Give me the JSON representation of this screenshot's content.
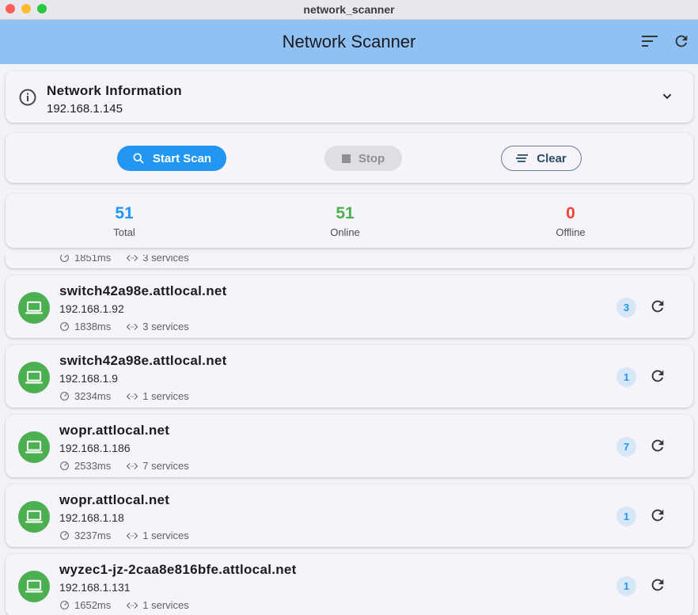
{
  "window": {
    "title": "network_scanner"
  },
  "appbar": {
    "title": "Network Scanner",
    "actions": [
      "sort-icon",
      "refresh-icon"
    ]
  },
  "network_info": {
    "title": "Network Information",
    "ip": "192.168.1.145"
  },
  "controls": {
    "start_label": "Start Scan",
    "stop_label": "Stop",
    "clear_label": "Clear"
  },
  "stats": {
    "total": {
      "value": "51",
      "label": "Total",
      "color": "#2196f3"
    },
    "online": {
      "value": "51",
      "label": "Online",
      "color": "#4caf50"
    },
    "offline": {
      "value": "0",
      "label": "Offline",
      "color": "#f44336"
    }
  },
  "partial_device": {
    "latency": "1851ms",
    "services": "3 services"
  },
  "devices": [
    {
      "host": "switch42a98e.attlocal.net",
      "ip": "192.168.1.92",
      "latency": "1838ms",
      "services": "3 services",
      "count": "3"
    },
    {
      "host": "switch42a98e.attlocal.net",
      "ip": "192.168.1.9",
      "latency": "3234ms",
      "services": "1 services",
      "count": "1"
    },
    {
      "host": "wopr.attlocal.net",
      "ip": "192.168.1.186",
      "latency": "2533ms",
      "services": "7 services",
      "count": "7"
    },
    {
      "host": "wopr.attlocal.net",
      "ip": "192.168.1.18",
      "latency": "3237ms",
      "services": "1 services",
      "count": "1"
    },
    {
      "host": "wyzec1-jz-2caa8e816bfe.attlocal.net",
      "ip": "192.168.1.131",
      "latency": "1652ms",
      "services": "1 services",
      "count": "1"
    }
  ],
  "colors": {
    "accent": "#2196f3",
    "appbar": "#90c1f5",
    "online": "#4caf50",
    "offline": "#f44336"
  }
}
